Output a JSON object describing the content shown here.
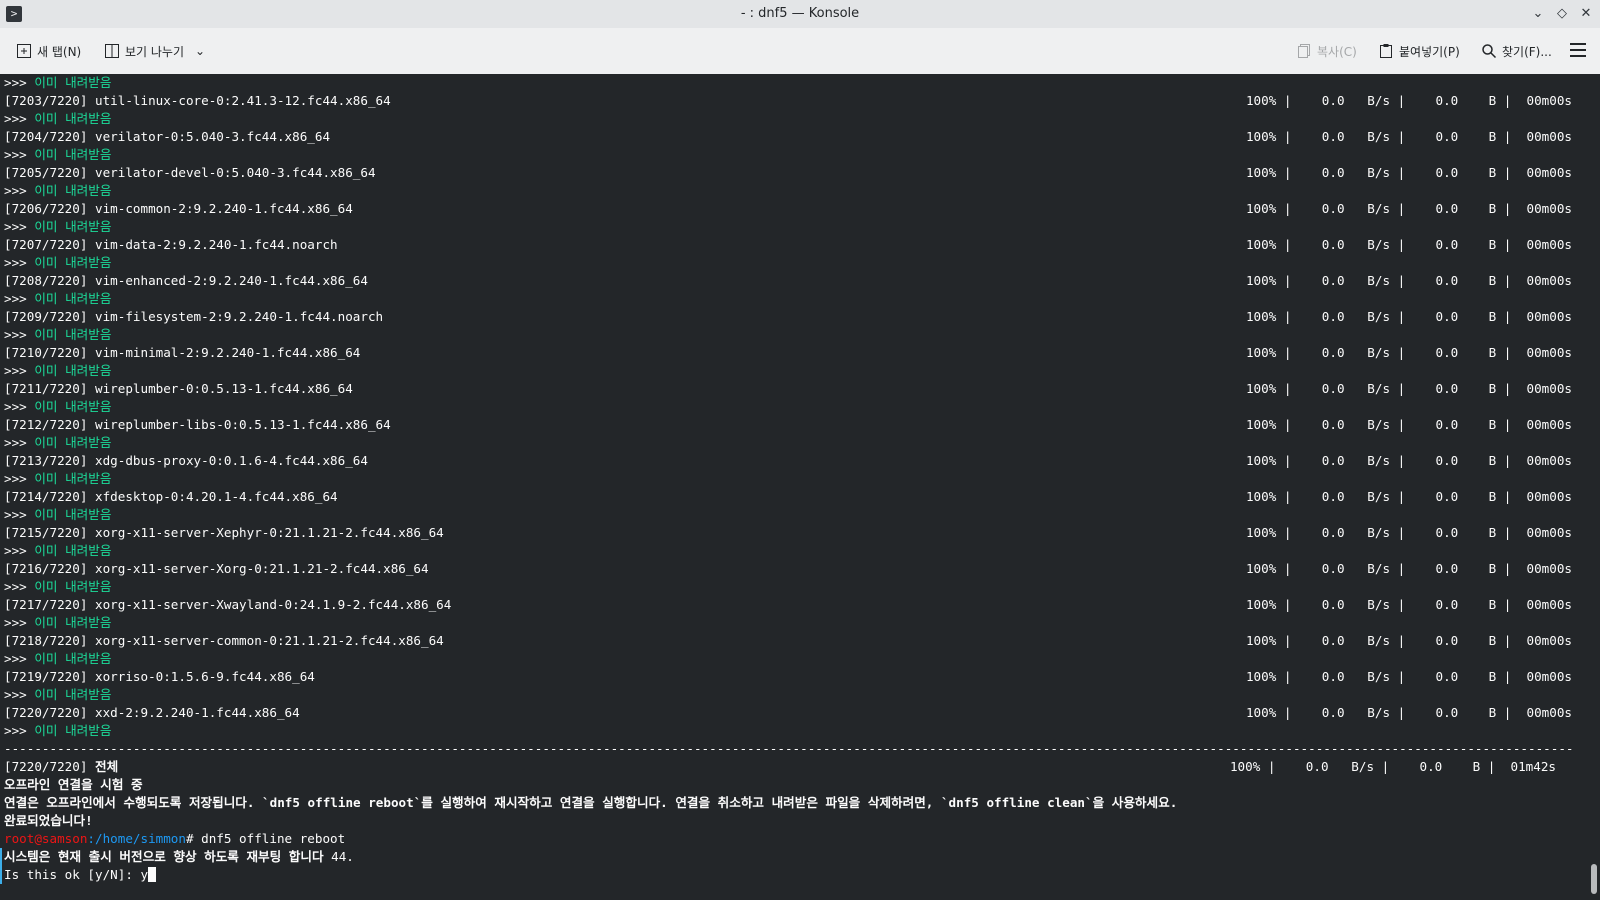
{
  "window": {
    "title": "- : dnf5 — Konsole",
    "icon": "konsole-icon"
  },
  "toolbar": {
    "new_tab": "새 탭(N)",
    "split_view": "보기 나누기",
    "copy": "복사(C)",
    "paste": "붙여넣기(P)",
    "find": "찾기(F)..."
  },
  "terminal": {
    "already_downloaded": "이미 내려받음",
    "prompt_marker": ">>> ",
    "packages": [
      {
        "idx": "[7203/7220]",
        "name": "util-linux-core-0:2.41.3-12.fc44.x86_64"
      },
      {
        "idx": "[7204/7220]",
        "name": "verilator-0:5.040-3.fc44.x86_64"
      },
      {
        "idx": "[7205/7220]",
        "name": "verilator-devel-0:5.040-3.fc44.x86_64"
      },
      {
        "idx": "[7206/7220]",
        "name": "vim-common-2:9.2.240-1.fc44.x86_64"
      },
      {
        "idx": "[7207/7220]",
        "name": "vim-data-2:9.2.240-1.fc44.noarch"
      },
      {
        "idx": "[7208/7220]",
        "name": "vim-enhanced-2:9.2.240-1.fc44.x86_64"
      },
      {
        "idx": "[7209/7220]",
        "name": "vim-filesystem-2:9.2.240-1.fc44.noarch"
      },
      {
        "idx": "[7210/7220]",
        "name": "vim-minimal-2:9.2.240-1.fc44.x86_64"
      },
      {
        "idx": "[7211/7220]",
        "name": "wireplumber-0:0.5.13-1.fc44.x86_64"
      },
      {
        "idx": "[7212/7220]",
        "name": "wireplumber-libs-0:0.5.13-1.fc44.x86_64"
      },
      {
        "idx": "[7213/7220]",
        "name": "xdg-dbus-proxy-0:0.1.6-4.fc44.x86_64"
      },
      {
        "idx": "[7214/7220]",
        "name": "xfdesktop-0:4.20.1-4.fc44.x86_64"
      },
      {
        "idx": "[7215/7220]",
        "name": "xorg-x11-server-Xephyr-0:21.1.21-2.fc44.x86_64"
      },
      {
        "idx": "[7216/7220]",
        "name": "xorg-x11-server-Xorg-0:21.1.21-2.fc44.x86_64"
      },
      {
        "idx": "[7217/7220]",
        "name": "xorg-x11-server-Xwayland-0:24.1.9-2.fc44.x86_64"
      },
      {
        "idx": "[7218/7220]",
        "name": "xorg-x11-server-common-0:21.1.21-2.fc44.x86_64"
      },
      {
        "idx": "[7219/7220]",
        "name": "xorriso-0:1.5.6-9.fc44.x86_64"
      },
      {
        "idx": "[7220/7220]",
        "name": "xxd-2:9.2.240-1.fc44.x86_64"
      }
    ],
    "pkg_stats": "100% |    0.0   B/s |    0.0    B |  00m00s",
    "total_idx": "[7220/7220]",
    "total_label": "전체",
    "total_stats": "100% |    0.0   B/s |    0.0    B |  01m42s",
    "line_testing": "오프라인 연결을 시험 중",
    "line_saved": "연결은 오프라인에서 수행되도록 저장됩니다. `dnf5 offline reboot`를 실행하여 재시작하고 연결을 실행합니다. 연결을 취소하고 내려받은 파일을 삭제하려면, `dnf5 offline clean`을 사용하세요.",
    "line_done": "완료되었습니다!",
    "prompt_user": "root@samson",
    "prompt_path": ":/home/simmon",
    "prompt_cmd": "# dnf5 offline reboot",
    "line_reboot": "시스템은 현재 출시 버전으로 향상 하도록 재부팅 합니다",
    "line_reboot_version": " 44.",
    "line_confirm": "Is this ok [y/N]: y"
  }
}
